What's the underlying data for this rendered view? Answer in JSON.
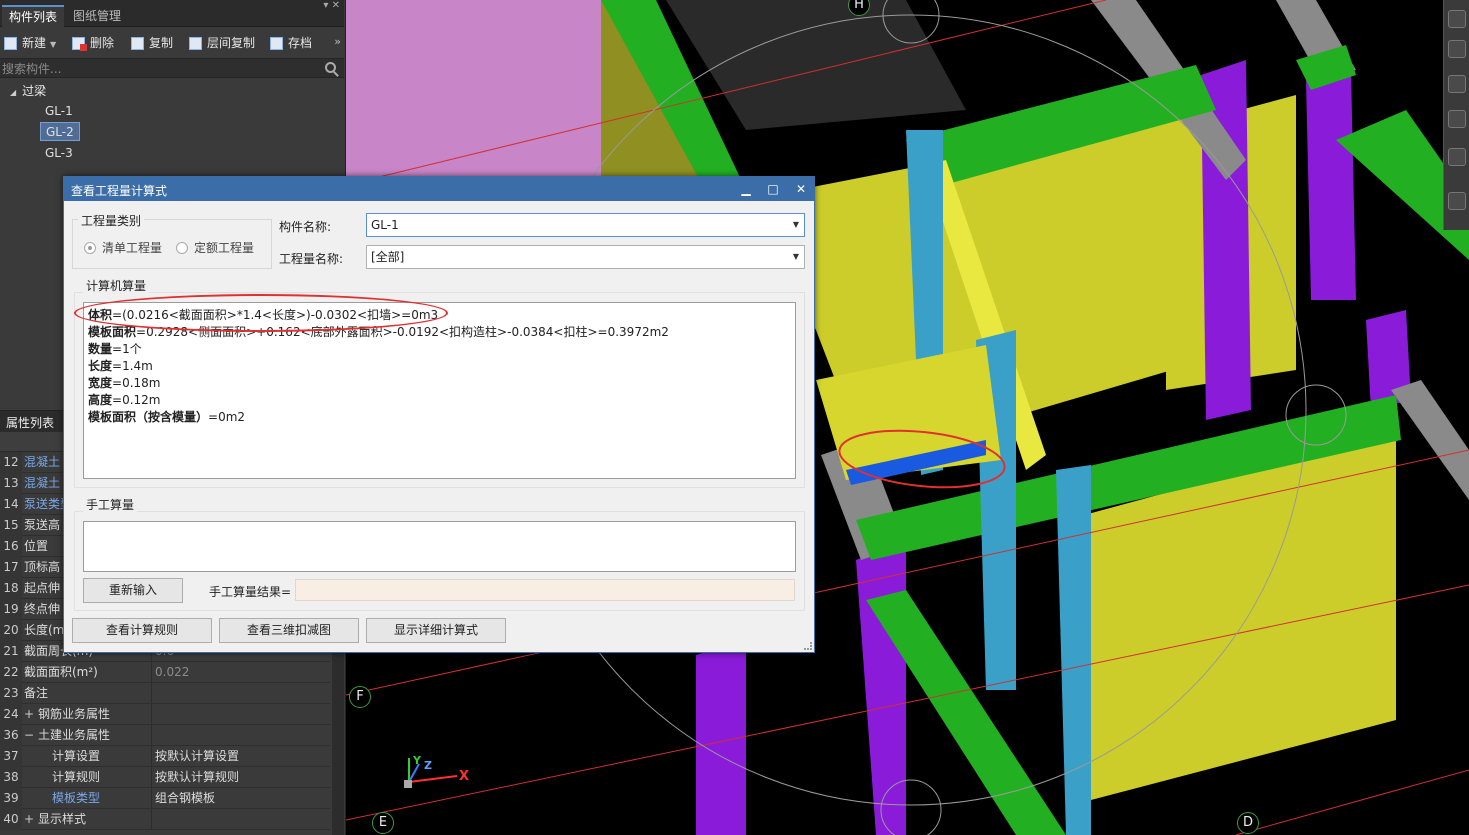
{
  "left_panel": {
    "tabs": [
      "构件列表",
      "图纸管理"
    ],
    "pin": "▾ ✕",
    "toolbar": {
      "new": "新建",
      "delete": "删除",
      "copy": "复制",
      "floor_copy": "层间复制",
      "archive": "存档",
      "more": "»"
    },
    "search": {
      "placeholder": "搜索构件..."
    },
    "tree": {
      "root": "过梁",
      "items": [
        "GL-1",
        "GL-2",
        "GL-3"
      ],
      "selected": "GL-2"
    },
    "properties": {
      "title": "属性列表",
      "rows": [
        {
          "num": "12",
          "name": "混凝土",
          "value": "",
          "blue": true
        },
        {
          "num": "13",
          "name": "混凝土",
          "value": "",
          "blue": true
        },
        {
          "num": "14",
          "name": "泵送类型",
          "value": "",
          "blue": true
        },
        {
          "num": "15",
          "name": "泵送高",
          "value": ""
        },
        {
          "num": "16",
          "name": "位置",
          "value": ""
        },
        {
          "num": "17",
          "name": "顶标高",
          "value": ""
        },
        {
          "num": "18",
          "name": "起点伸",
          "value": ""
        },
        {
          "num": "19",
          "name": "终点伸",
          "value": ""
        },
        {
          "num": "20",
          "name": "长度(m)",
          "value": ""
        },
        {
          "num": "21",
          "name": "截面周长(m)",
          "value": "0.6"
        },
        {
          "num": "22",
          "name": "截面面积(m²)",
          "value": "0.022"
        },
        {
          "num": "23",
          "name": "备注",
          "value": ""
        },
        {
          "num": "24",
          "name": "钢筋业务属性",
          "value": "",
          "expand": "+"
        },
        {
          "num": "36",
          "name": "土建业务属性",
          "value": "",
          "expand": "−"
        },
        {
          "num": "37",
          "name": "计算设置",
          "value": "按默认计算设置",
          "indent": true
        },
        {
          "num": "38",
          "name": "计算规则",
          "value": "按默认计算规则",
          "indent": true
        },
        {
          "num": "39",
          "name": "模板类型",
          "value": "组合钢模板",
          "indent": true,
          "blue": true
        },
        {
          "num": "40",
          "name": "显示样式",
          "value": "",
          "expand": "+"
        }
      ]
    }
  },
  "viewport": {
    "axis_labels": {
      "h": "H",
      "f": "F",
      "e": "E",
      "d": "D"
    },
    "gizmo": {
      "x": "X",
      "y": "Y",
      "z": "Z"
    },
    "colors": {
      "green": "#22b022",
      "yellow": "#cccc2a",
      "purple": "#8a1bd8",
      "cyan": "#3aa0c8",
      "blue_beam": "#1a5ae0",
      "pink": "#c886c8",
      "gray": "#8a8a8a",
      "olive": "#8f8f22"
    }
  },
  "dialog": {
    "title": "查看工程量计算式",
    "window_buttons": {
      "min": "▁",
      "max": "□",
      "close": "✕"
    },
    "quantity_category": {
      "label": "工程量类别",
      "options": [
        "清单工程量",
        "定额工程量"
      ],
      "selected": "清单工程量"
    },
    "component_name": {
      "label": "构件名称:",
      "value": "GL-1"
    },
    "quantity_name": {
      "label": "工程量名称:",
      "value": "[全部]"
    },
    "computer": {
      "label": "计算机算量",
      "lines": [
        {
          "key": "体积",
          "rest": "=(0.0216<截面面积>*1.4<长度>)-0.0302<扣墙>=0m3"
        },
        {
          "key": "模板面积",
          "rest": "=0.2928<侧面面积>+0.162<底部外露面积>-0.0192<扣构造柱>-0.0384<扣柱>=0.3972m2"
        },
        {
          "key": "数量",
          "rest": "=1个"
        },
        {
          "key": "长度",
          "rest": "=1.4m"
        },
        {
          "key": "宽度",
          "rest": "=0.18m"
        },
        {
          "key": "高度",
          "rest": "=0.12m"
        },
        {
          "key": "模板面积（按含模量）",
          "rest": "=0m2"
        }
      ]
    },
    "manual": {
      "label": "手工算量",
      "reinput": "重新输入",
      "result_label": "手工算量结果="
    },
    "buttons": {
      "rules": "查看计算规则",
      "view3d": "查看三维扣减图",
      "detail": "显示详细计算式"
    }
  }
}
